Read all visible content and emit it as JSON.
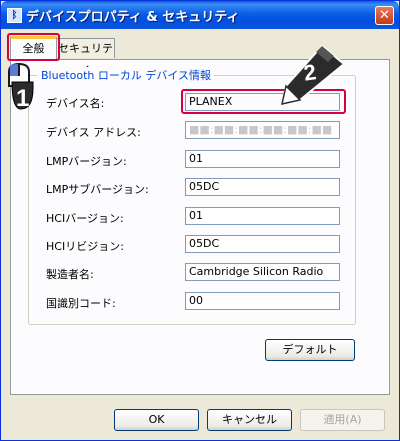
{
  "window": {
    "title": "デバイスプロパティ & セキュリティ",
    "close_glyph": "✕"
  },
  "tabs": [
    {
      "label": "全般",
      "selected": true
    },
    {
      "label": "セキュリティ",
      "selected": false
    }
  ],
  "group": {
    "title": "Bluetooth ローカル デバイス情報"
  },
  "fields": [
    {
      "label": "デバイス名:",
      "value": "PLANEX",
      "editable": true
    },
    {
      "label": "デバイス アドレス:",
      "value": "■■:■■:■■:■■:■■:■■",
      "editable": false
    },
    {
      "label": "LMPバージョン:",
      "value": "01",
      "editable": false
    },
    {
      "label": "LMPサブバージョン:",
      "value": "05DC",
      "editable": false
    },
    {
      "label": "HCIバージョン:",
      "value": "01",
      "editable": false
    },
    {
      "label": "HCIリビジョン:",
      "value": "05DC",
      "editable": false
    },
    {
      "label": "製造者名:",
      "value": "Cambridge Silicon Radio",
      "editable": false
    },
    {
      "label": "国識別コード:",
      "value": "00",
      "editable": false
    }
  ],
  "buttons": {
    "default": "デフォルト",
    "ok": "OK",
    "cancel": "キャンセル",
    "apply": "適用(A)"
  },
  "annotations": {
    "step1": "1",
    "step2": "2",
    "color": "#d40040"
  }
}
